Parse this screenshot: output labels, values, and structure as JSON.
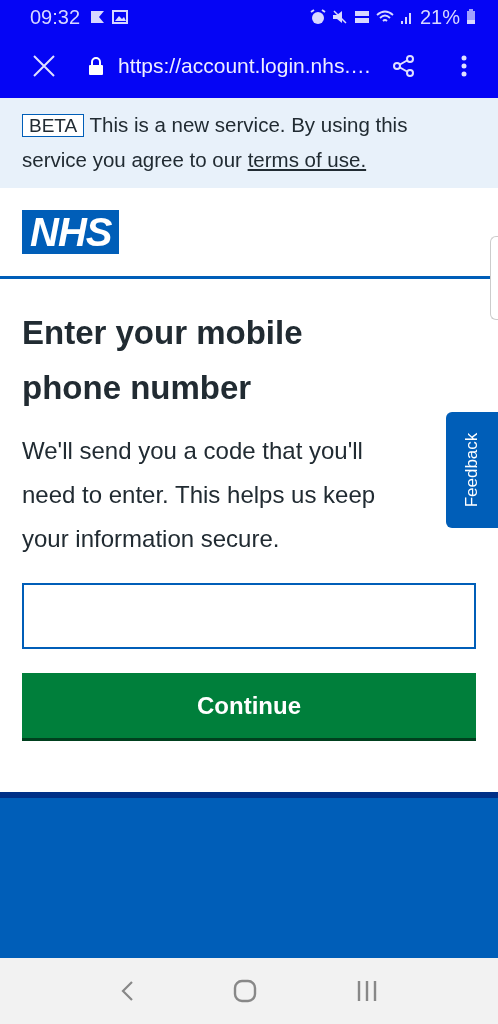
{
  "status_bar": {
    "time": "09:32",
    "battery": "21%"
  },
  "browser": {
    "url": "https://account.login.nhs.…"
  },
  "beta_banner": {
    "tag": "BETA",
    "text": "This is a new service. By using this service you agree to our",
    "link": "terms of use."
  },
  "logo": {
    "text": "NHS"
  },
  "heading": "Enter your mobile phone number",
  "intro": "We'll send you a code that you'll need to enter. This helps us keep your information secure.",
  "continue_button": "Continue",
  "feedback_tab": "Feedback"
}
